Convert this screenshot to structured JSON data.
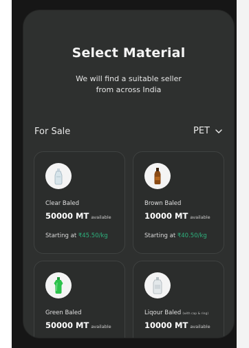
{
  "header": {
    "title": "Select Material",
    "subtitle_line1": "We will find a suitable seller",
    "subtitle_line2": "from across India"
  },
  "filter": {
    "label": "For Sale",
    "selected": "PET"
  },
  "colors": {
    "background": "#2e302f",
    "card_border": "#3f4241",
    "price_accent": "#2db37e"
  },
  "materials": [
    {
      "name": "Clear Baled",
      "note": "",
      "quantity": "50000 MT",
      "availability": "available",
      "price_prefix": "Starting at",
      "price": "₹45.50/kg",
      "icon": "clear-bottle-icon"
    },
    {
      "name": "Brown Baled",
      "note": "",
      "quantity": "10000 MT",
      "availability": "available",
      "price_prefix": "Starting at",
      "price": "₹40.50/kg",
      "icon": "brown-bottle-icon"
    },
    {
      "name": "Green Baled",
      "note": "",
      "quantity": "50000 MT",
      "availability": "available",
      "icon": "green-bottle-icon"
    },
    {
      "name": "Liqour Baled",
      "note": "(with cap & ring)",
      "quantity": "10000 MT",
      "availability": "available",
      "icon": "liquor-bottle-icon"
    }
  ]
}
